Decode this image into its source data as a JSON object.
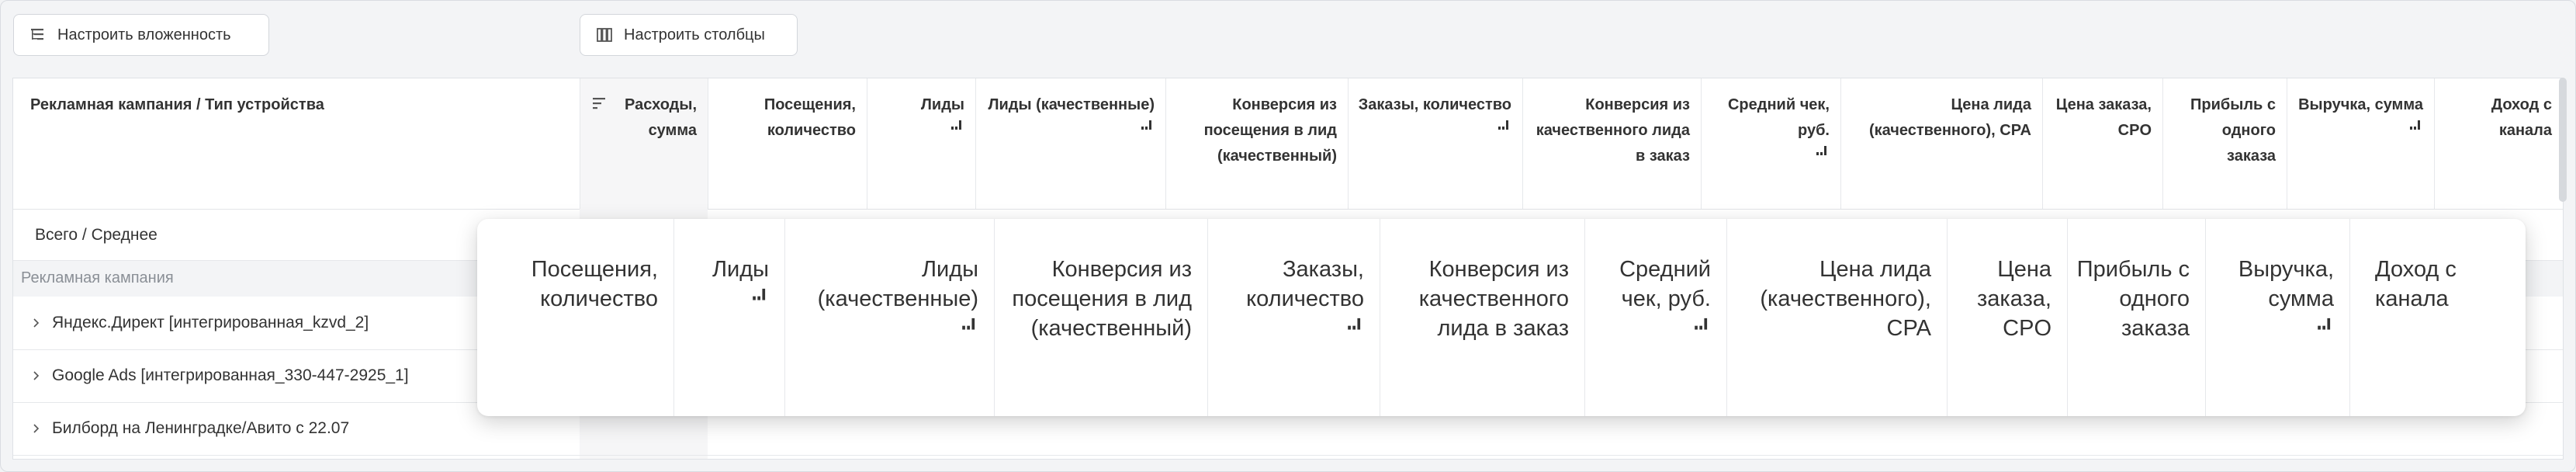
{
  "toolbar": {
    "nesting_label": "Настроить вложенность",
    "columns_label": "Настроить столбцы"
  },
  "table": {
    "columns": [
      "Рекламная кампания / Тип устройства",
      "Расходы, сумма",
      "Посещения, количество",
      "Лиды",
      "Лиды (качественные)",
      "Конверсия из посещения в лид (качественный)",
      "Заказы, количество",
      "Конверсия из качественного лида в заказ",
      "Средний чек, руб.",
      "Цена лида (качественного), CPA",
      "Цена заказа, CPO",
      "Прибыль с одного заказа",
      "Выручка, сумма",
      "Доход с канала"
    ],
    "total_label": "Всего / Среднее",
    "group_label": "Рекламная кампания",
    "rows": [
      "Яндекс.Директ [интегрированная_kzvd_2]",
      "Google Ads [интегрированная_330-447-2925_1]",
      "Билборд на Ленинградке/Авито с 22.07"
    ]
  },
  "overlay": {
    "columns": [
      "Посещения, количество",
      "Лиды",
      "Лиды (качественные)",
      "Конверсия из посещения в лид (качественный)",
      "Заказы, количество",
      "Конверсия из качественного лида в заказ",
      "Средний чек, руб.",
      "Цена лида (качественного), CPA",
      "Цена заказа, CPO",
      "Прибыль с одного заказа",
      "Выручка, сумма",
      "Доход с канала"
    ]
  },
  "colors": {
    "accent_bg": "#f6f6f7",
    "border": "#e6e8eb",
    "page_bg": "#f3f4f6"
  },
  "icons": {
    "nesting": "tree-icon",
    "columns": "columns-icon",
    "sort": "sort-icon",
    "mini_bar": "mini-bars-icon",
    "expand": "chevron-right-icon"
  }
}
